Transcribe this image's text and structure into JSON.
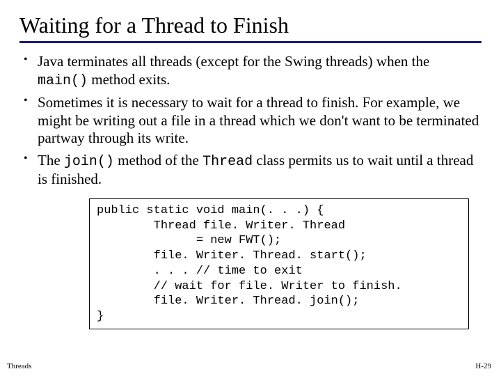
{
  "title": "Waiting for a Thread to Finish",
  "bullets": [
    {
      "pre": "Java terminates all threads (except for the Swing threads) when the ",
      "code": "main()",
      "post": " method exits."
    },
    {
      "pre": "Sometimes it is necessary to wait for a thread to finish.  For example, we might be writing out a file in a thread which we don't want to be terminated partway through its write.",
      "code": "",
      "post": ""
    },
    {
      "pre": "The ",
      "code": "join()",
      "mid": " method of the ",
      "code2": "Thread",
      "post": " class permits us to wait until a thread is finished."
    }
  ],
  "code": {
    "l1": "public static void main(. . .) {",
    "l2": "        Thread file. Writer. Thread",
    "l3": "              = new FWT();",
    "l4": "        file. Writer. Thread. start();",
    "l5": "        . . . // time to exit",
    "l6": "        // wait for file. Writer to finish.",
    "l7": "        file. Writer. Thread. join();",
    "l8": "}"
  },
  "footer": {
    "left": "Threads",
    "right": "H-29"
  }
}
